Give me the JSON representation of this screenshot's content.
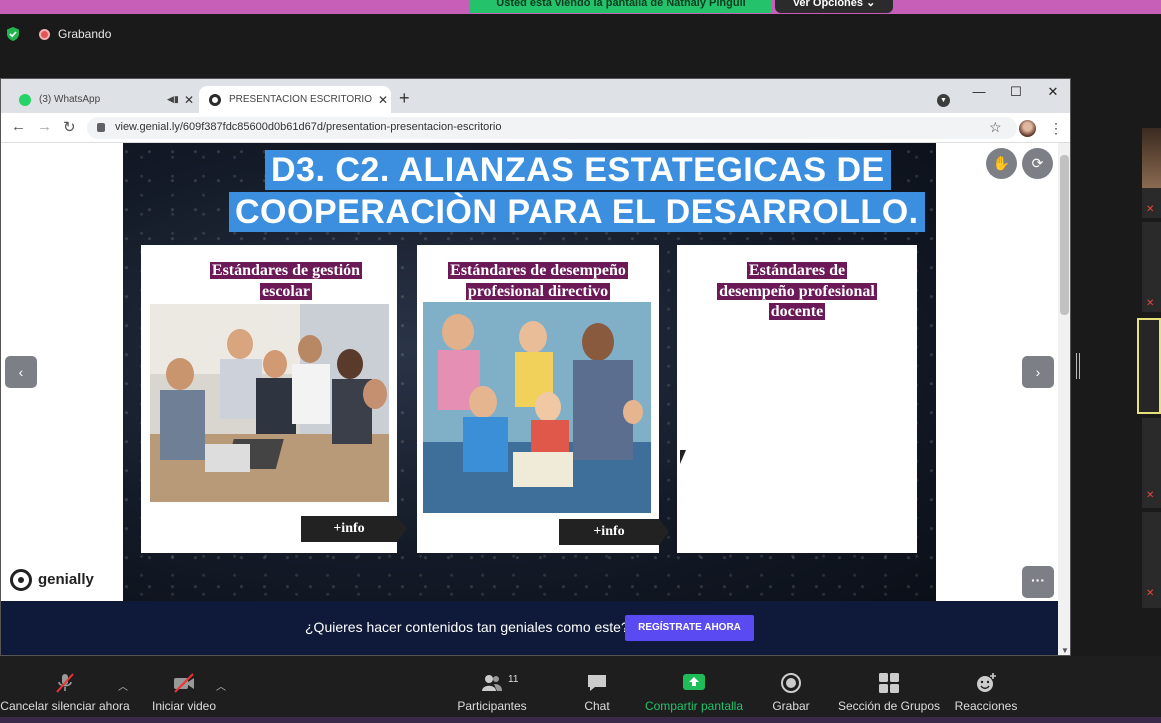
{
  "zoom": {
    "share_banner": "Usted está viendo la pantalla de Nathaly Pinguil",
    "view_options": "Ver Opciones ⌄",
    "recording_label": "Grabando"
  },
  "browser": {
    "tabs": [
      {
        "title": "(3) WhatsApp",
        "favicon_color": "#25d366",
        "active": false
      },
      {
        "title": "PRESENTACIÓN ESCRITORIO por",
        "favicon_color": "#2b2b2b",
        "active": true
      }
    ],
    "url": "view.genial.ly/609f387fdc85600d0b61d67d/presentation-presentacion-escritorio"
  },
  "slide": {
    "title_line1": "D3. C2. ALIANZAS ESTATEGICAS DE",
    "title_line2": "COOPERACIÒN PARA EL DESARROLLO.",
    "cards": [
      {
        "heading_line1": "Estándares de gestión",
        "heading_line2": "escolar",
        "info": "+info"
      },
      {
        "heading_line1": "Estándares de desempeño",
        "heading_line2": "profesional directivo",
        "info": "+info"
      },
      {
        "heading_line1": "Estándares de",
        "heading_line2": "desempeño profesional",
        "heading_line3": "docente"
      }
    ],
    "prev_icon": "‹",
    "next_icon": "›",
    "more_icon": "···",
    "brand": "genially"
  },
  "cta": {
    "text": "¿Quieres hacer contenidos tan geniales como este?",
    "button": "REGÍSTRATE AHORA"
  },
  "toolbar": {
    "mute_label": "Cancelar silenciar ahora",
    "video_label": "Iniciar video",
    "participants_label": "Participantes",
    "participants_count": "11",
    "chat_label": "Chat",
    "share_label": "Compartir pantalla",
    "record_label": "Grabar",
    "breakout_label": "Sección de Grupos",
    "reactions_label": "Reacciones"
  },
  "colors": {
    "share_green": "#23c26b",
    "title_blue": "#3b8fde",
    "heading_purple": "#6b1a57",
    "cta_purple": "#5a4af2"
  }
}
